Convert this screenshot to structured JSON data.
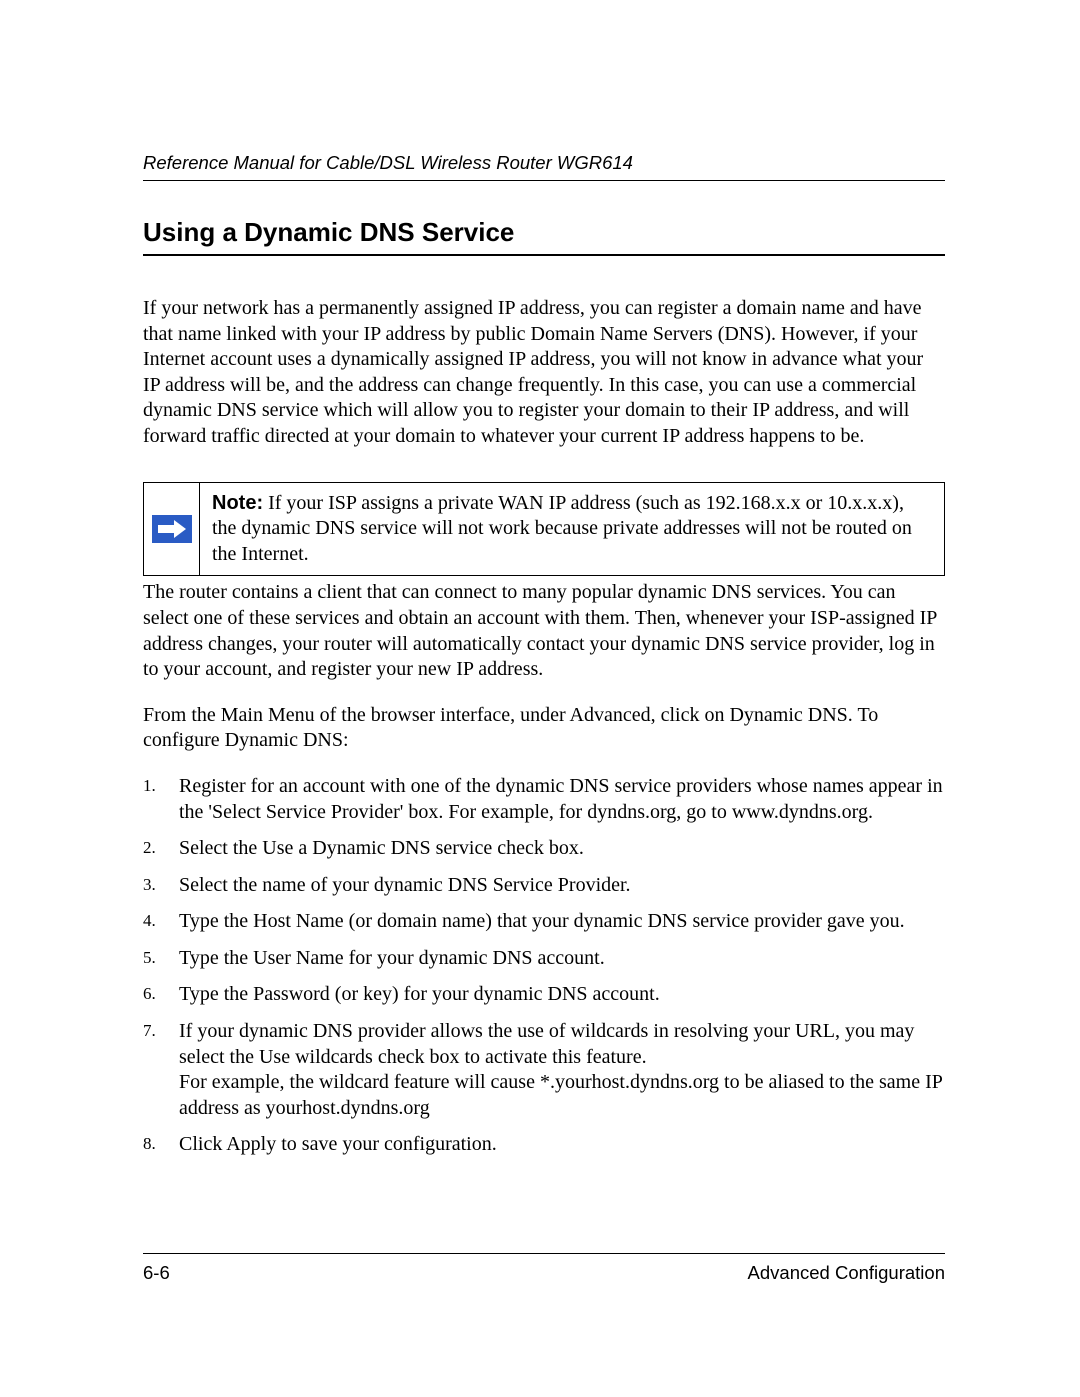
{
  "header": {
    "running_title": "Reference Manual for Cable/DSL Wireless Router WGR614"
  },
  "section": {
    "heading": "Using a Dynamic DNS Service",
    "intro": "If your network has a permanently assigned IP address, you can register a domain name and have that name linked with your IP address by public Domain Name Servers (DNS). However, if your Internet account uses a dynamically assigned IP address, you will not know in advance what your IP address will be, and the address can change frequently. In this case, you can use a commercial dynamic DNS service which will allow you to register your domain to their IP address, and will forward traffic directed at your domain to whatever your current IP address happens to be.",
    "note": {
      "label": "Note:",
      "text": " If your ISP assigns a private WAN IP address (such as 192.168.x.x or 10.x.x.x), the dynamic DNS service will not work because private addresses will not be routed on the Internet."
    },
    "para2": "The router contains a client that can connect to many popular dynamic DNS services. You can select one of these services and obtain an account with them. Then, whenever your ISP-assigned IP address changes, your router will automatically contact your dynamic DNS service provider, log in to your account, and register your new IP address.",
    "para3": "From the Main Menu of the browser interface, under Advanced, click on Dynamic DNS. To configure Dynamic DNS:",
    "steps": [
      "Register for an account with one of the dynamic DNS service providers whose names appear in the 'Select Service Provider' box. For example, for dyndns.org, go to www.dyndns.org.",
      "Select the Use a Dynamic DNS service check box.",
      "Select the name of your dynamic DNS Service Provider.",
      "Type the Host Name (or domain name) that your dynamic DNS service provider gave you.",
      "Type the User Name for your dynamic DNS account.",
      "Type the Password (or key) for your dynamic DNS account.",
      "If your dynamic DNS provider allows the use of wildcards in resolving your URL, you may select the Use wildcards check box to activate this feature.\nFor example, the wildcard feature will cause *.yourhost.dyndns.org to be aliased to the same IP address as yourhost.dyndns.org",
      "Click Apply to save your configuration."
    ]
  },
  "footer": {
    "page_number": "6-6",
    "chapter": "Advanced Configuration"
  }
}
